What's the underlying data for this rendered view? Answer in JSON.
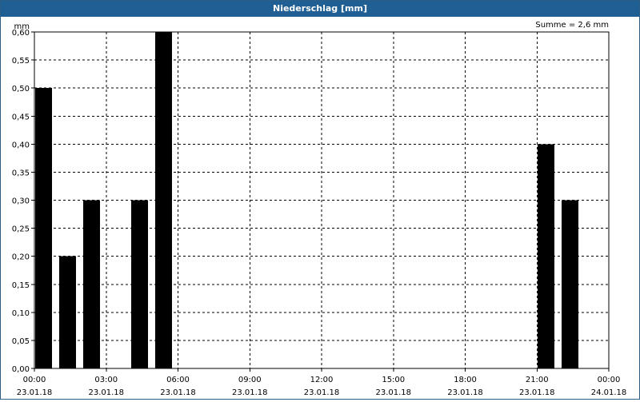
{
  "window": {
    "title": "Niederschlag [mm]"
  },
  "chart_data": {
    "type": "bar",
    "title": "Niederschlag [mm]",
    "unit_label": "mm",
    "summary": "Summe = 2,6 mm",
    "bar_color": "#000000",
    "grid": true,
    "x_range_hours": [
      0,
      24
    ],
    "y_range": [
      0,
      0.6
    ],
    "y_ticks": [
      {
        "value": 0.0,
        "label": "0,00"
      },
      {
        "value": 0.05,
        "label": "0,05"
      },
      {
        "value": 0.1,
        "label": "0,10"
      },
      {
        "value": 0.15,
        "label": "0,15"
      },
      {
        "value": 0.2,
        "label": "0,20"
      },
      {
        "value": 0.25,
        "label": "0,25"
      },
      {
        "value": 0.3,
        "label": "0,30"
      },
      {
        "value": 0.35,
        "label": "0,35"
      },
      {
        "value": 0.4,
        "label": "0,40"
      },
      {
        "value": 0.45,
        "label": "0,45"
      },
      {
        "value": 0.5,
        "label": "0,50"
      },
      {
        "value": 0.55,
        "label": "0,55"
      },
      {
        "value": 0.6,
        "label": "0,60"
      }
    ],
    "x_ticks": [
      {
        "hour": 0,
        "time": "00:00",
        "date": "23.01.18"
      },
      {
        "hour": 3,
        "time": "03:00",
        "date": "23.01.18"
      },
      {
        "hour": 6,
        "time": "06:00",
        "date": "23.01.18"
      },
      {
        "hour": 9,
        "time": "09:00",
        "date": "23.01.18"
      },
      {
        "hour": 12,
        "time": "12:00",
        "date": "23.01.18"
      },
      {
        "hour": 15,
        "time": "15:00",
        "date": "23.01.18"
      },
      {
        "hour": 18,
        "time": "18:00",
        "date": "23.01.18"
      },
      {
        "hour": 21,
        "time": "21:00",
        "date": "23.01.18"
      },
      {
        "hour": 24,
        "time": "00:00",
        "date": "24.01.18"
      }
    ],
    "bars": [
      {
        "start_hour": 0,
        "end_hour": 1,
        "value": 0.5
      },
      {
        "start_hour": 1,
        "end_hour": 2,
        "value": 0.2
      },
      {
        "start_hour": 2,
        "end_hour": 3,
        "value": 0.3
      },
      {
        "start_hour": 4,
        "end_hour": 5,
        "value": 0.3
      },
      {
        "start_hour": 5,
        "end_hour": 6,
        "value": 0.6
      },
      {
        "start_hour": 21,
        "end_hour": 22,
        "value": 0.4
      },
      {
        "start_hour": 22,
        "end_hour": 23,
        "value": 0.3
      }
    ]
  }
}
